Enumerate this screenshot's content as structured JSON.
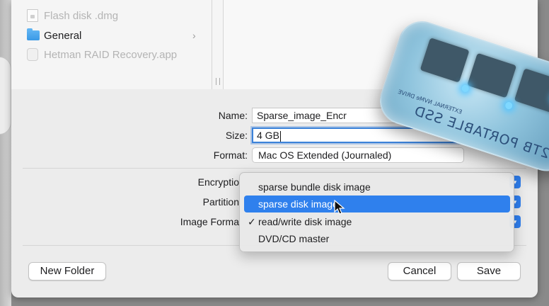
{
  "files": [
    {
      "label": "Flash disk .dmg",
      "dimmed": true,
      "icon": "document-icon"
    },
    {
      "label": "General",
      "dimmed": false,
      "icon": "folder-icon",
      "chevron": "›"
    },
    {
      "label": "Hetman RAID Recovery.app",
      "dimmed": true,
      "icon": "app-icon"
    }
  ],
  "form": {
    "name_label": "Name:",
    "name_value": "Sparse_image_Encr",
    "size_label": "Size:",
    "size_value": "4 GB",
    "format_label": "Format:",
    "format_value": "Mac OS Extended (Journaled)",
    "encryption_label": "Encryptio",
    "partition_label": "Partition",
    "image_format_label": "Image Forma"
  },
  "menu": {
    "items": [
      {
        "label": "sparse bundle disk image",
        "selected": false,
        "checked": false
      },
      {
        "label": "sparse disk image",
        "selected": true,
        "checked": false
      },
      {
        "label": "read/write disk image",
        "selected": false,
        "checked": true
      },
      {
        "label": "DVD/CD master",
        "selected": false,
        "checked": false
      }
    ],
    "check_glyph": "✓"
  },
  "buttons": {
    "new_folder": "New Folder",
    "cancel": "Cancel",
    "save": "Save"
  },
  "overlay": {
    "product_text": "2TB PORTABLE SSD",
    "product_sub": "EXTERNAL NVMe DRIVE"
  },
  "colors": {
    "accent": "#2f80ed",
    "dialog_bg": "#ececec"
  }
}
